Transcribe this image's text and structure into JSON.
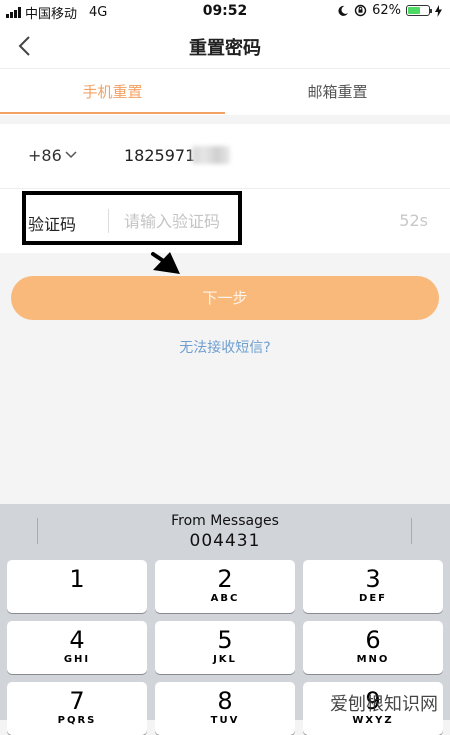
{
  "status_bar": {
    "carrier": "中国移动",
    "network": "4G",
    "time": "09:52",
    "battery_percent": "62%",
    "battery_level": 0.62
  },
  "nav": {
    "title": "重置密码"
  },
  "tabs": [
    {
      "label": "手机重置",
      "active": true
    },
    {
      "label": "邮箱重置",
      "active": false
    }
  ],
  "form": {
    "country_code": "+86",
    "phone_number": "1825971",
    "code_label": "验证码",
    "code_placeholder": "请输入验证码",
    "countdown": "52s"
  },
  "actions": {
    "next_label": "下一步",
    "no_sms_label": "无法接收短信?"
  },
  "keyboard": {
    "suggestion_title": "From Messages",
    "suggestion_code": "004431",
    "keys": [
      {
        "num": "1",
        "letters": ""
      },
      {
        "num": "2",
        "letters": "ABC"
      },
      {
        "num": "3",
        "letters": "DEF"
      },
      {
        "num": "4",
        "letters": "GHI"
      },
      {
        "num": "5",
        "letters": "JKL"
      },
      {
        "num": "6",
        "letters": "MNO"
      },
      {
        "num": "7",
        "letters": "PQRS"
      },
      {
        "num": "8",
        "letters": "TUV"
      },
      {
        "num": "9",
        "letters": "WXYZ"
      }
    ]
  },
  "watermark": "爱刨根知识网",
  "colors": {
    "accent": "#f4a263",
    "button": "#f9b97a",
    "link": "#6f9fd1"
  }
}
